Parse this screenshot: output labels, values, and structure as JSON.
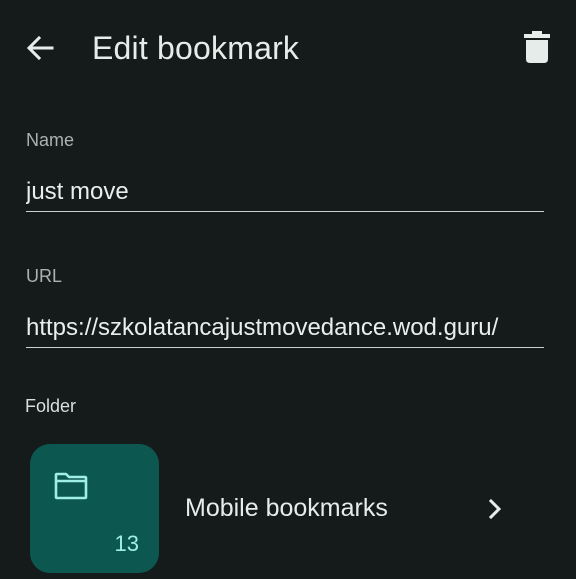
{
  "header": {
    "title": "Edit bookmark",
    "back_icon": "arrow-back-icon",
    "delete_icon": "trash-icon"
  },
  "name_field": {
    "label": "Name",
    "value": "just move"
  },
  "url_field": {
    "label": "URL",
    "value": "https://szkolatancajustmovedance.wod.guru/"
  },
  "folder": {
    "label": "Folder",
    "name": "Mobile bookmarks",
    "count": "13",
    "icon": "folder-icon",
    "chevron_icon": "chevron-right-icon"
  },
  "colors": {
    "background": "#141b1a",
    "tile": "#0d5751",
    "accent": "#9ff0e4",
    "text": "#e6ecea",
    "label": "#a9b3b0"
  }
}
